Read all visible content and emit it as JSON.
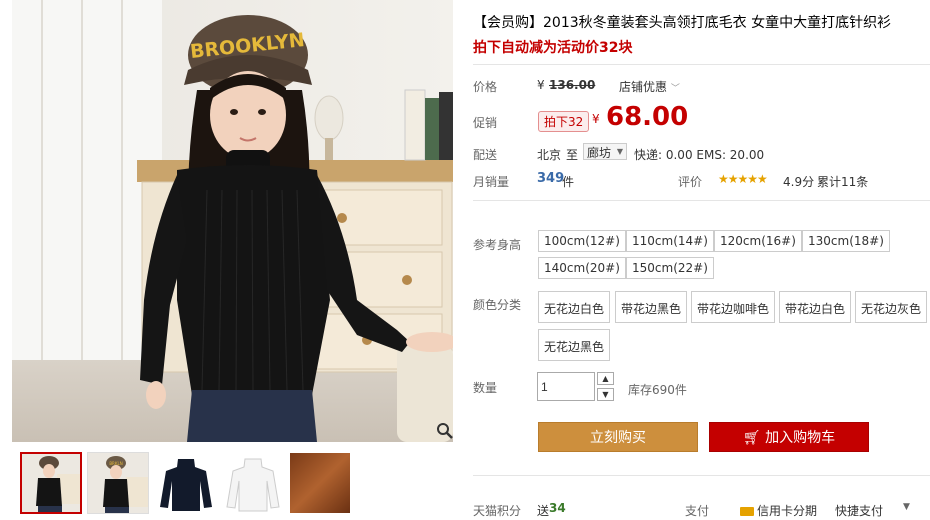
{
  "product": {
    "title": "【会员购】2013秋冬童装套头高领打底毛衣 女童中大童打底针织衫",
    "subtitle": "拍下自动减为活动价32块"
  },
  "price": {
    "label": "价格",
    "currency": "¥",
    "original": "136.00",
    "store_discount": "店铺优惠",
    "promo_label": "促销",
    "promo_tag": "拍下32",
    "promo_price": "68.00"
  },
  "delivery": {
    "label": "配送",
    "from": "北京",
    "to_label": "至",
    "to_city": "廊坊",
    "shipping": "快递: 0.00 EMS: 20.00"
  },
  "sales": {
    "label": "月销量",
    "count": "349",
    "unit": "件",
    "rating_label": "评价",
    "stars": "★★★★★",
    "score": "4.9分",
    "reviews": "累计11条"
  },
  "size": {
    "label": "参考身高",
    "options": [
      "100cm(12#)",
      "110cm(14#)",
      "120cm(16#)",
      "130cm(18#)",
      "140cm(20#)",
      "150cm(22#)"
    ]
  },
  "color": {
    "label": "颜色分类",
    "options": [
      "无花边白色",
      "带花边黑色",
      "带花边咖啡色",
      "带花边白色",
      "无花边灰色",
      "无花边黑色"
    ]
  },
  "quantity": {
    "label": "数量",
    "value": "1",
    "stock": "库存690件"
  },
  "actions": {
    "buy_now": "立刻购买",
    "add_to_cart": "加入购物车"
  },
  "footer": {
    "points_label": "天猫积分",
    "points_prefix": "送",
    "points_value": "34",
    "pay_label": "支付",
    "credit_installment": "信用卡分期",
    "quick_pay": "快捷支付"
  },
  "photo_text": {
    "hat": "BROOKLYN"
  }
}
